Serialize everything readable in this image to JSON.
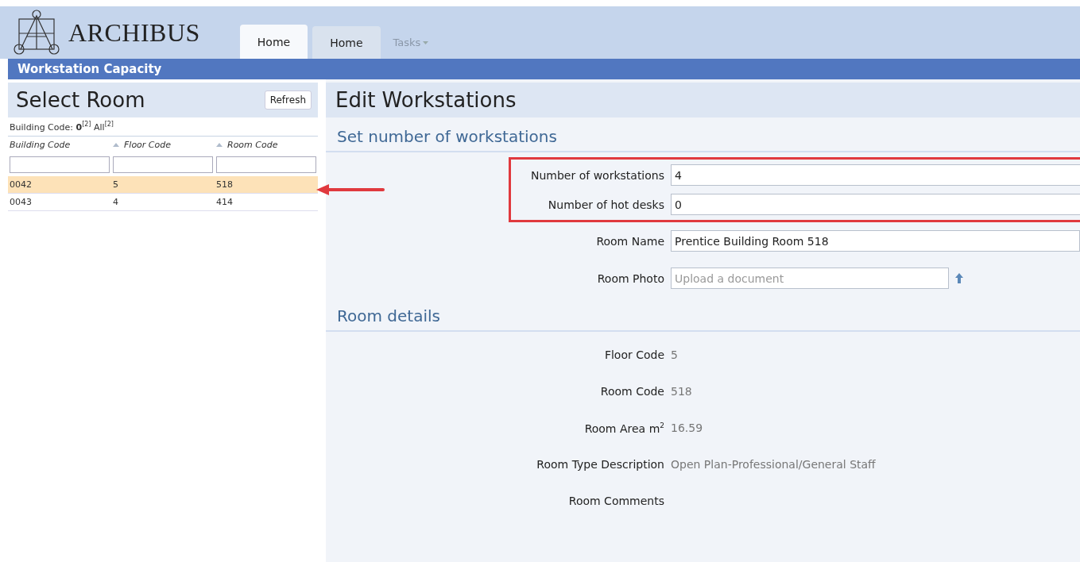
{
  "header": {
    "logo": "ARCHIBUS",
    "tabs": [
      {
        "label": "Home",
        "selected": true,
        "kind": "tab"
      },
      {
        "label": "Home",
        "selected": false,
        "kind": "tab"
      },
      {
        "label": "Tasks",
        "selected": false,
        "kind": "menu"
      }
    ]
  },
  "title_bar": {
    "title": "Workstation Capacity"
  },
  "left_panel": {
    "title": "Select Room",
    "refresh": "Refresh",
    "filter": "Building Code: **0**$^{[2]}$ All$^{[2]}$",
    "columns": [
      "Building Code",
      "Floor Code",
      "Room Code"
    ],
    "rows": [
      {
        "cells": [
          "0042",
          "5",
          "518"
        ],
        "selected": true
      },
      {
        "cells": [
          "0043",
          "4",
          "414"
        ],
        "selected": false
      }
    ]
  },
  "right_panel": {
    "title": "Edit Workstations",
    "sections": [
      {
        "title": "Set number of workstations",
        "fields": [
          {
            "label": "Number of workstations",
            "value": "4",
            "kind": "input",
            "highlighted": true
          },
          {
            "label": "Number of hot desks",
            "value": "0",
            "kind": "input",
            "highlighted": true
          },
          {
            "label": "Room Name",
            "value": "Prentice Building Room 518",
            "kind": "input",
            "highlighted": false
          },
          {
            "label": "Room Photo",
            "placeholder": "Upload a document",
            "kind": "file",
            "highlighted": false
          }
        ]
      },
      {
        "title": "Room details",
        "fields": [
          {
            "label": "Floor Code",
            "value": "5",
            "kind": "readonly",
            "highlighted": false
          },
          {
            "label": "Room Code",
            "value": "518",
            "kind": "readonly",
            "highlighted": false
          },
          {
            "label": "Room Area m$^{2}$",
            "value": "16.59",
            "kind": "readonly",
            "highlighted": false
          },
          {
            "label": "Room Type Description",
            "value": "Open Plan-Professional/General Staff",
            "kind": "readonly",
            "highlighted": false
          },
          {
            "label": "Room Comments",
            "kind": "readonly",
            "highlighted": false
          }
        ]
      }
    ]
  }
}
